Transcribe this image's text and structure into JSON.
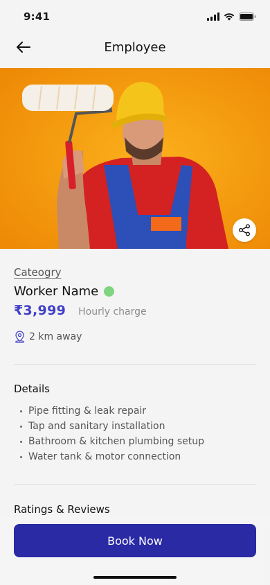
{
  "status_bar": {
    "time": "9:41"
  },
  "header": {
    "title": "Employee"
  },
  "hero": {
    "image_alt": "worker-photo"
  },
  "profile": {
    "category": "Cateogry",
    "worker_name": "Worker Name",
    "online_color": "#7fd47f",
    "price": "₹3,999",
    "price_note": "Hourly charge",
    "distance": "2 km away"
  },
  "details": {
    "title": "Details",
    "items": [
      "Pipe fitting & leak repair",
      "Tap and sanitary installation",
      "Bathroom & kitchen plumbing setup",
      "Water tank & motor connection"
    ]
  },
  "ratings": {
    "title": "Ratings & Reviews"
  },
  "actions": {
    "book_label": "Book Now"
  },
  "colors": {
    "accent": "#3f3fc7",
    "button": "#2a2aa5",
    "hero_bg": "#f29a10"
  }
}
